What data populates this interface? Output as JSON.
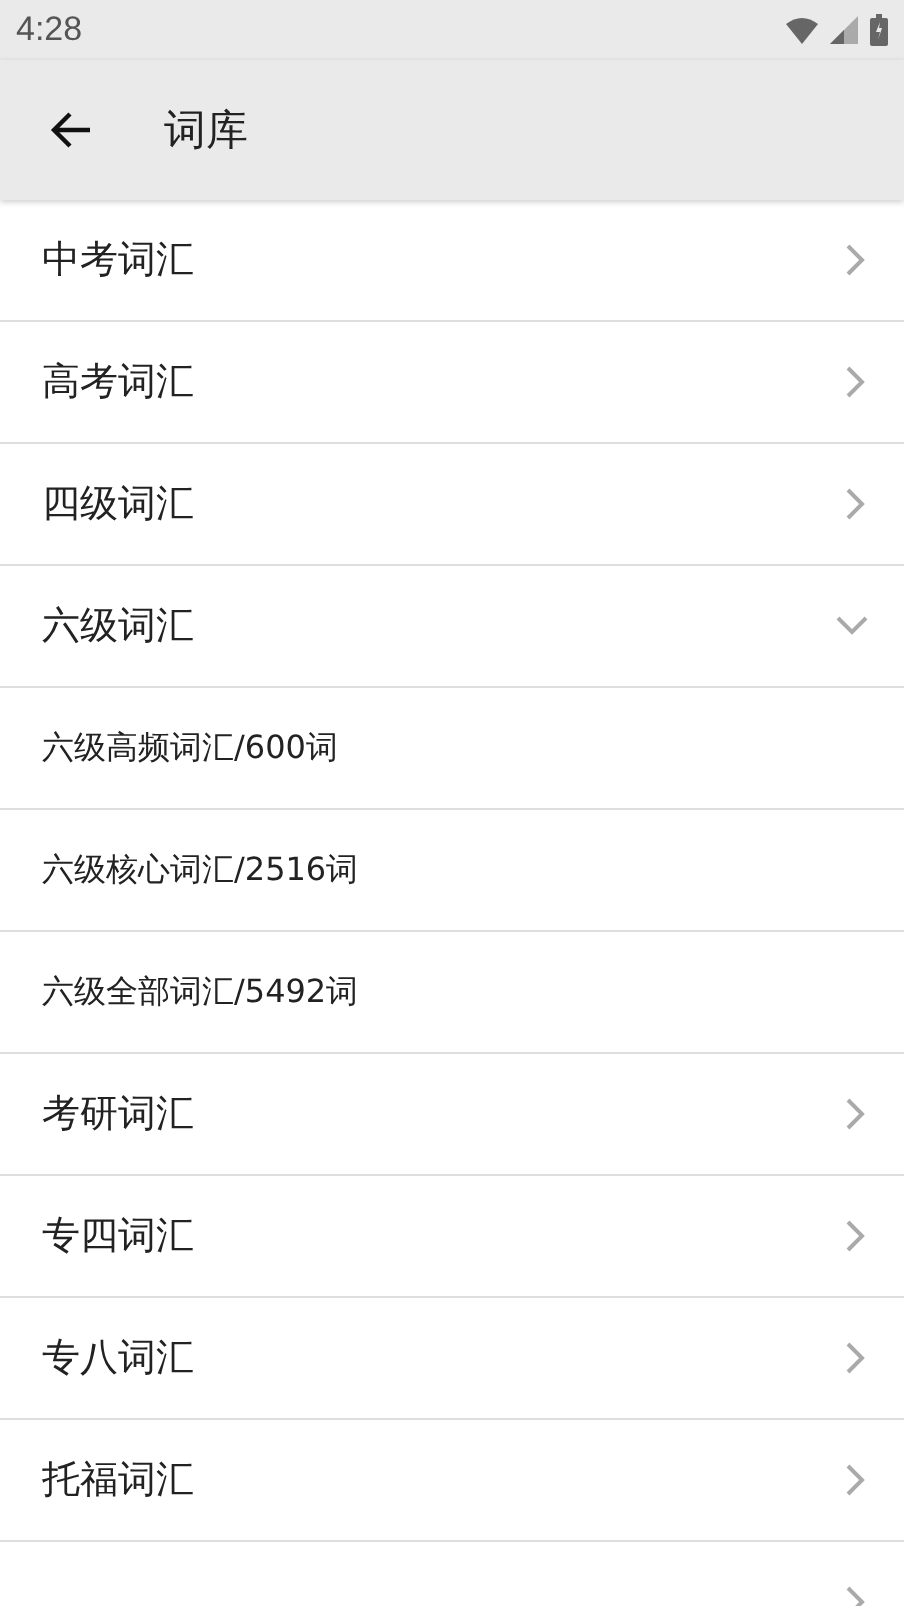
{
  "status_bar": {
    "time": "4:28"
  },
  "toolbar": {
    "title": "词库"
  },
  "categories": [
    {
      "label": "中考词汇",
      "expanded": false
    },
    {
      "label": "高考词汇",
      "expanded": false
    },
    {
      "label": "四级词汇",
      "expanded": false
    },
    {
      "label": "六级词汇",
      "expanded": true,
      "children": [
        {
          "label": "六级高频词汇/600词"
        },
        {
          "label": "六级核心词汇/2516词"
        },
        {
          "label": "六级全部词汇/5492词"
        }
      ]
    },
    {
      "label": "考研词汇",
      "expanded": false
    },
    {
      "label": "专四词汇",
      "expanded": false
    },
    {
      "label": "专八词汇",
      "expanded": false
    },
    {
      "label": "托福词汇",
      "expanded": false
    },
    {
      "expanded": false
    }
  ]
}
